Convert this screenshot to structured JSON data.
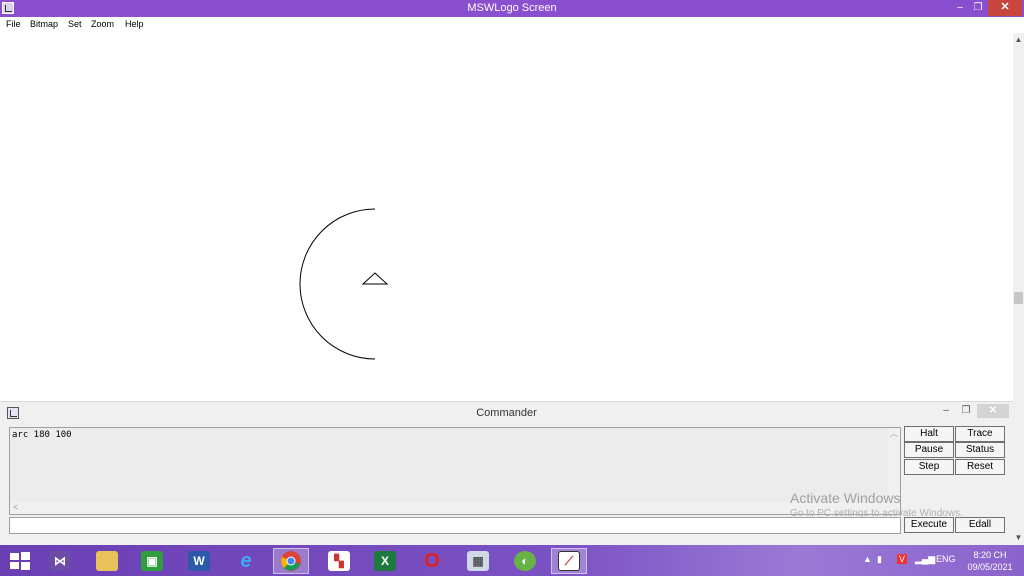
{
  "window": {
    "title": "MSWLogo Screen",
    "controls": {
      "minimize": "–",
      "maximize": "❐",
      "close": "✕"
    }
  },
  "menu": {
    "items": [
      "File",
      "Bitmap",
      "Set",
      "Zoom",
      "Help"
    ]
  },
  "canvas": {
    "drawing": {
      "arc_angle_degrees": 180,
      "arc_radius": 100,
      "turtle": "triangle-outline"
    }
  },
  "commander": {
    "title": "Commander",
    "controls": {
      "minimize": "–",
      "maximize": "❐",
      "close": "✕"
    },
    "history_lines": [
      "arc 180 100"
    ],
    "input_value": "",
    "buttons": {
      "halt": "Halt",
      "trace": "Trace",
      "pause": "Pause",
      "status": "Status",
      "step": "Step",
      "reset": "Reset",
      "execute": "Execute",
      "edall": "Edall"
    }
  },
  "watermark": {
    "title": "Activate Windows",
    "subtitle": "Go to PC settings to activate Windows."
  },
  "taskbar": {
    "apps": [
      {
        "name": "start-icon",
        "label": ""
      },
      {
        "name": "visual-studio-icon",
        "label": ""
      },
      {
        "name": "file-explorer-icon",
        "label": ""
      },
      {
        "name": "store-icon",
        "label": ""
      },
      {
        "name": "word-icon",
        "label": "W"
      },
      {
        "name": "internet-explorer-icon",
        "label": "e"
      },
      {
        "name": "chrome-icon",
        "label": ""
      },
      {
        "name": "paint-icon",
        "label": ""
      },
      {
        "name": "excel-icon",
        "label": "X"
      },
      {
        "name": "opera-icon",
        "label": "O"
      },
      {
        "name": "calculator-icon",
        "label": ""
      },
      {
        "name": "coccoc-icon",
        "label": ""
      },
      {
        "name": "mswlogo-icon",
        "label": ""
      }
    ],
    "tray": {
      "language": "ENG",
      "time": "8:20 CH",
      "date": "09/05/2021"
    }
  },
  "colors": {
    "titlebar": "#8a4fcf",
    "close_button": "#c7473e",
    "taskbar": "#7b52c4"
  }
}
